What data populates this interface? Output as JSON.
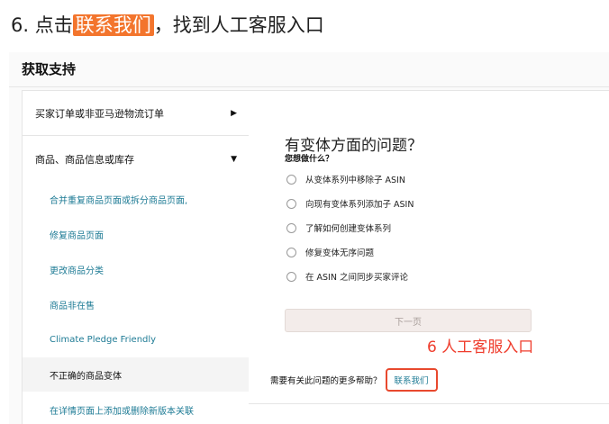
{
  "step": {
    "prefix": "6. 点击",
    "highlight": "联系我们",
    "suffix": "，找到人工客服入口"
  },
  "screenshot": {
    "title": "获取支持",
    "sidebar": {
      "categories": [
        {
          "label": "买家订单或非亚马逊物流订单",
          "arrow": "▶"
        },
        {
          "label": "商品、商品信息或库存",
          "arrow": "▼"
        }
      ],
      "subitems": [
        "合并重复商品页面或拆分商品页面,",
        "修复商品页面",
        "更改商品分类",
        "商品非在售",
        "Climate Pledge Friendly",
        "不正确的商品变体",
        "在详情页面上添加或删除新版本关联"
      ]
    },
    "panel": {
      "question": "有变体方面的问题？",
      "subquestion": "您想做什么？",
      "options": [
        "从变体系列中移除子 ASIN",
        "向现有变体系列添加子 ASIN",
        "了解如何创建变体系列",
        "修复变体无序问题",
        "在 ASIN 之间同步买家评论"
      ],
      "next_button": "下一页",
      "help_text": "需要有关此问题的更多帮助？",
      "contact_link": "联系我们"
    },
    "annotation": "6 人工客服入口",
    "colors": {
      "highlight": "#f3752d",
      "annotation": "#ef3d2d",
      "link": "#1e7b95"
    }
  }
}
